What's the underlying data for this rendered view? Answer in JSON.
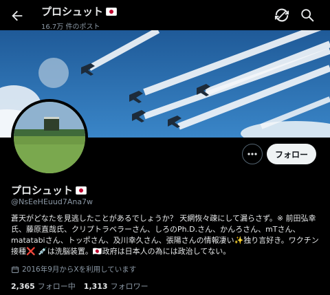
{
  "header": {
    "title": "プロシュット",
    "post_count": "16.7万 件のポスト",
    "icons": [
      "back-arrow-icon",
      "refresh-icon",
      "search-icon"
    ]
  },
  "banner": {
    "description_icons": [
      "moon",
      "blue-impulse-jets",
      "smoke-trails"
    ]
  },
  "profile": {
    "display_name": "プロシュット",
    "handle": "@NsEeHEuud7Ana7w",
    "follow_label": "フォロー",
    "bio_lines": [
      "蒼天がどなたを見逃したことがあるでしょうか？ 天網恢々疎にして漏らさず。※ 前田弘幸",
      "氏、藤原直哉氏、クリプトラベラーさん、しろのPh.D.さん、かんろさん、mTさん、",
      "matatabiさん、トッポさん、及川幸久さん、張陽さんの情報凄い✨独り言好き。ワクチン",
      "接種❌ 💉は洗脳装置。🇯🇵政府は日本人の為には政治してない。"
    ],
    "joined": "2016年9月からXを利用しています",
    "following_count": "2,365",
    "following_label": "フォロー中",
    "followers_count": "1,313",
    "followers_label": "フォロワー"
  },
  "colors": {
    "background": "#000000",
    "text": "#e7e9ea",
    "muted": "#8b98a5",
    "sky": "#2a6aa8"
  }
}
